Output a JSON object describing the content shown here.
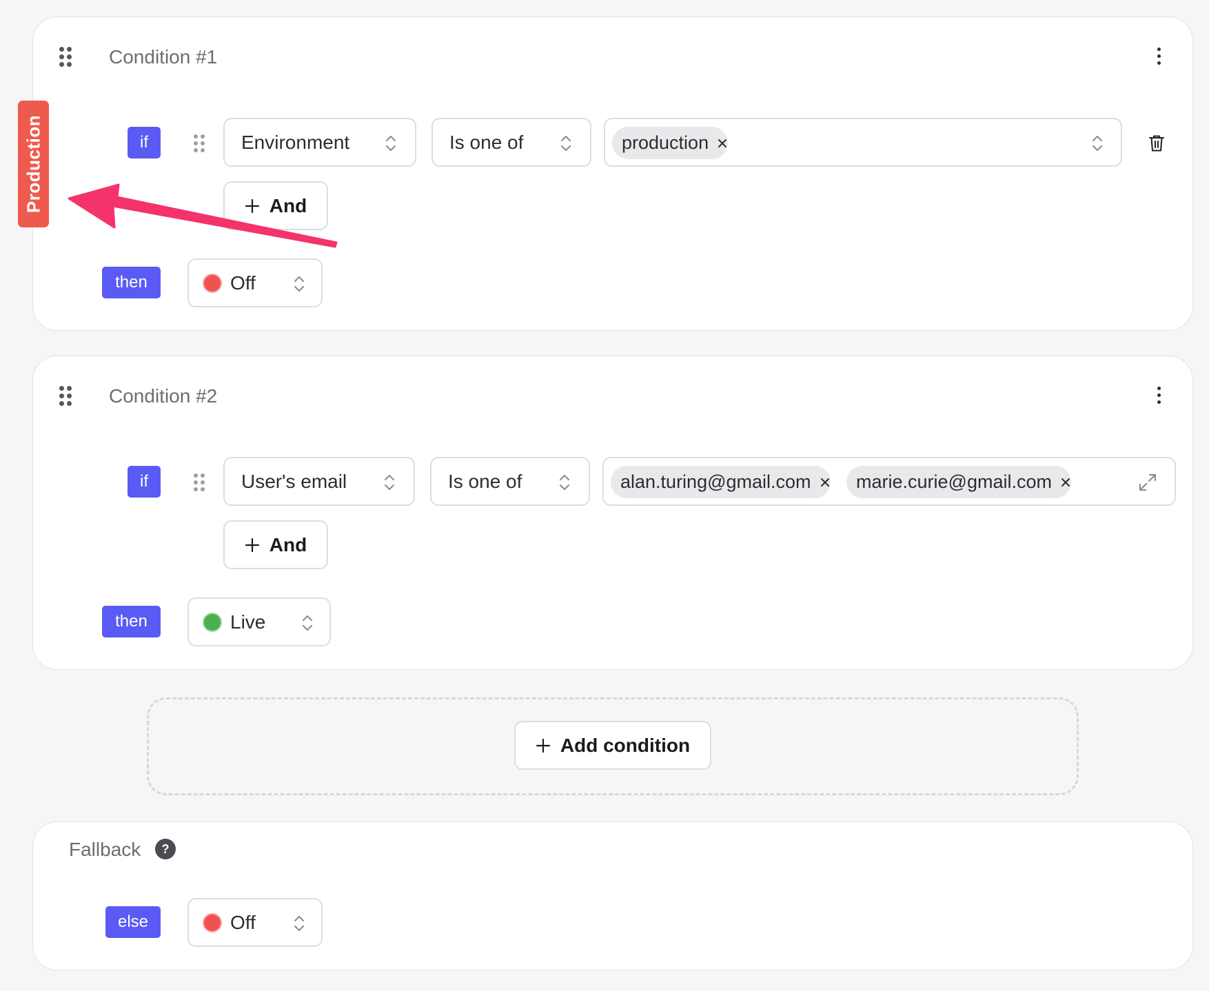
{
  "environment_tag": "Production",
  "colors": {
    "accent": "#5a5af5",
    "tag": "#ef5a4f",
    "arrow": "#f4336a",
    "off": "#ef5350",
    "live": "#4caf50"
  },
  "icons": {
    "drag": "grip-icon",
    "menu": "kebab-menu-icon",
    "dropdown": "chevron-updown-icon",
    "remove": "close-icon",
    "delete": "trash-icon",
    "expand": "expand-icon",
    "add": "plus-icon",
    "help": "question-icon"
  },
  "conditions": [
    {
      "title": "Condition #1",
      "if_label": "if",
      "attribute": "Environment",
      "operator": "Is one of",
      "values": [
        "production"
      ],
      "and_label": "And",
      "then_label": "then",
      "result": "Off",
      "result_status": "off"
    },
    {
      "title": "Condition #2",
      "if_label": "if",
      "attribute": "User's email",
      "operator": "Is one of",
      "values": [
        "alan.turing@gmail.com",
        "marie.curie@gmail.com"
      ],
      "and_label": "And",
      "then_label": "then",
      "result": "Live",
      "result_status": "live"
    }
  ],
  "add_condition_label": "Add condition",
  "fallback": {
    "title": "Fallback",
    "help_glyph": "?",
    "else_label": "else",
    "result": "Off",
    "result_status": "off"
  }
}
